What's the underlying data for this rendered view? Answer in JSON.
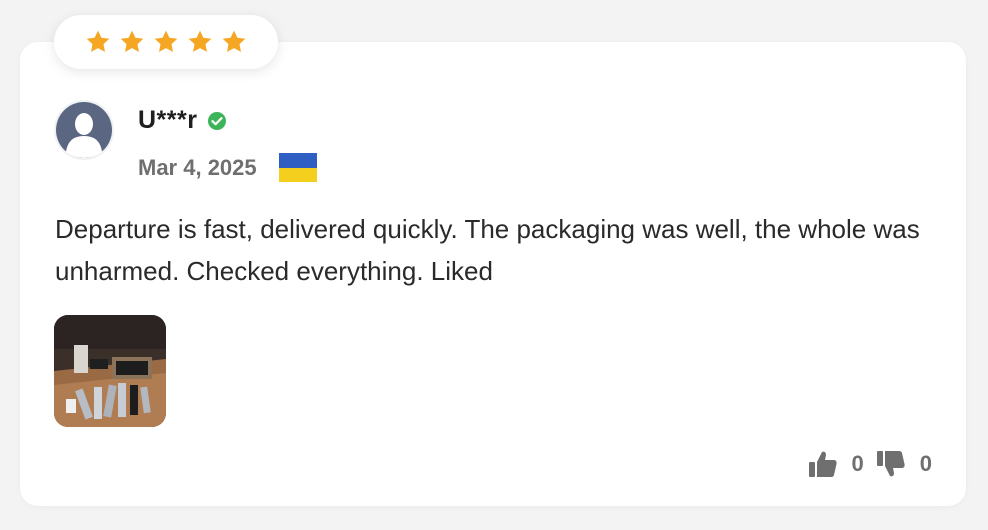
{
  "review": {
    "rating": 5,
    "username": "U***r",
    "verified_icon": "verified-check-icon",
    "date": "Mar 4, 2025",
    "country_flag": "ukraine-flag",
    "text": "Departure is fast, delivered quickly. The packaging was well, the whole was unharmed. Checked everything. Liked",
    "photo_count": 1,
    "helpful_count": "0",
    "not_helpful_count": "0"
  },
  "colors": {
    "star": "#f5a623",
    "verified": "#3db35a",
    "flag_blue": "#2f5fc2",
    "flag_yellow": "#f4cf1d",
    "avatar": "#5b6782"
  }
}
